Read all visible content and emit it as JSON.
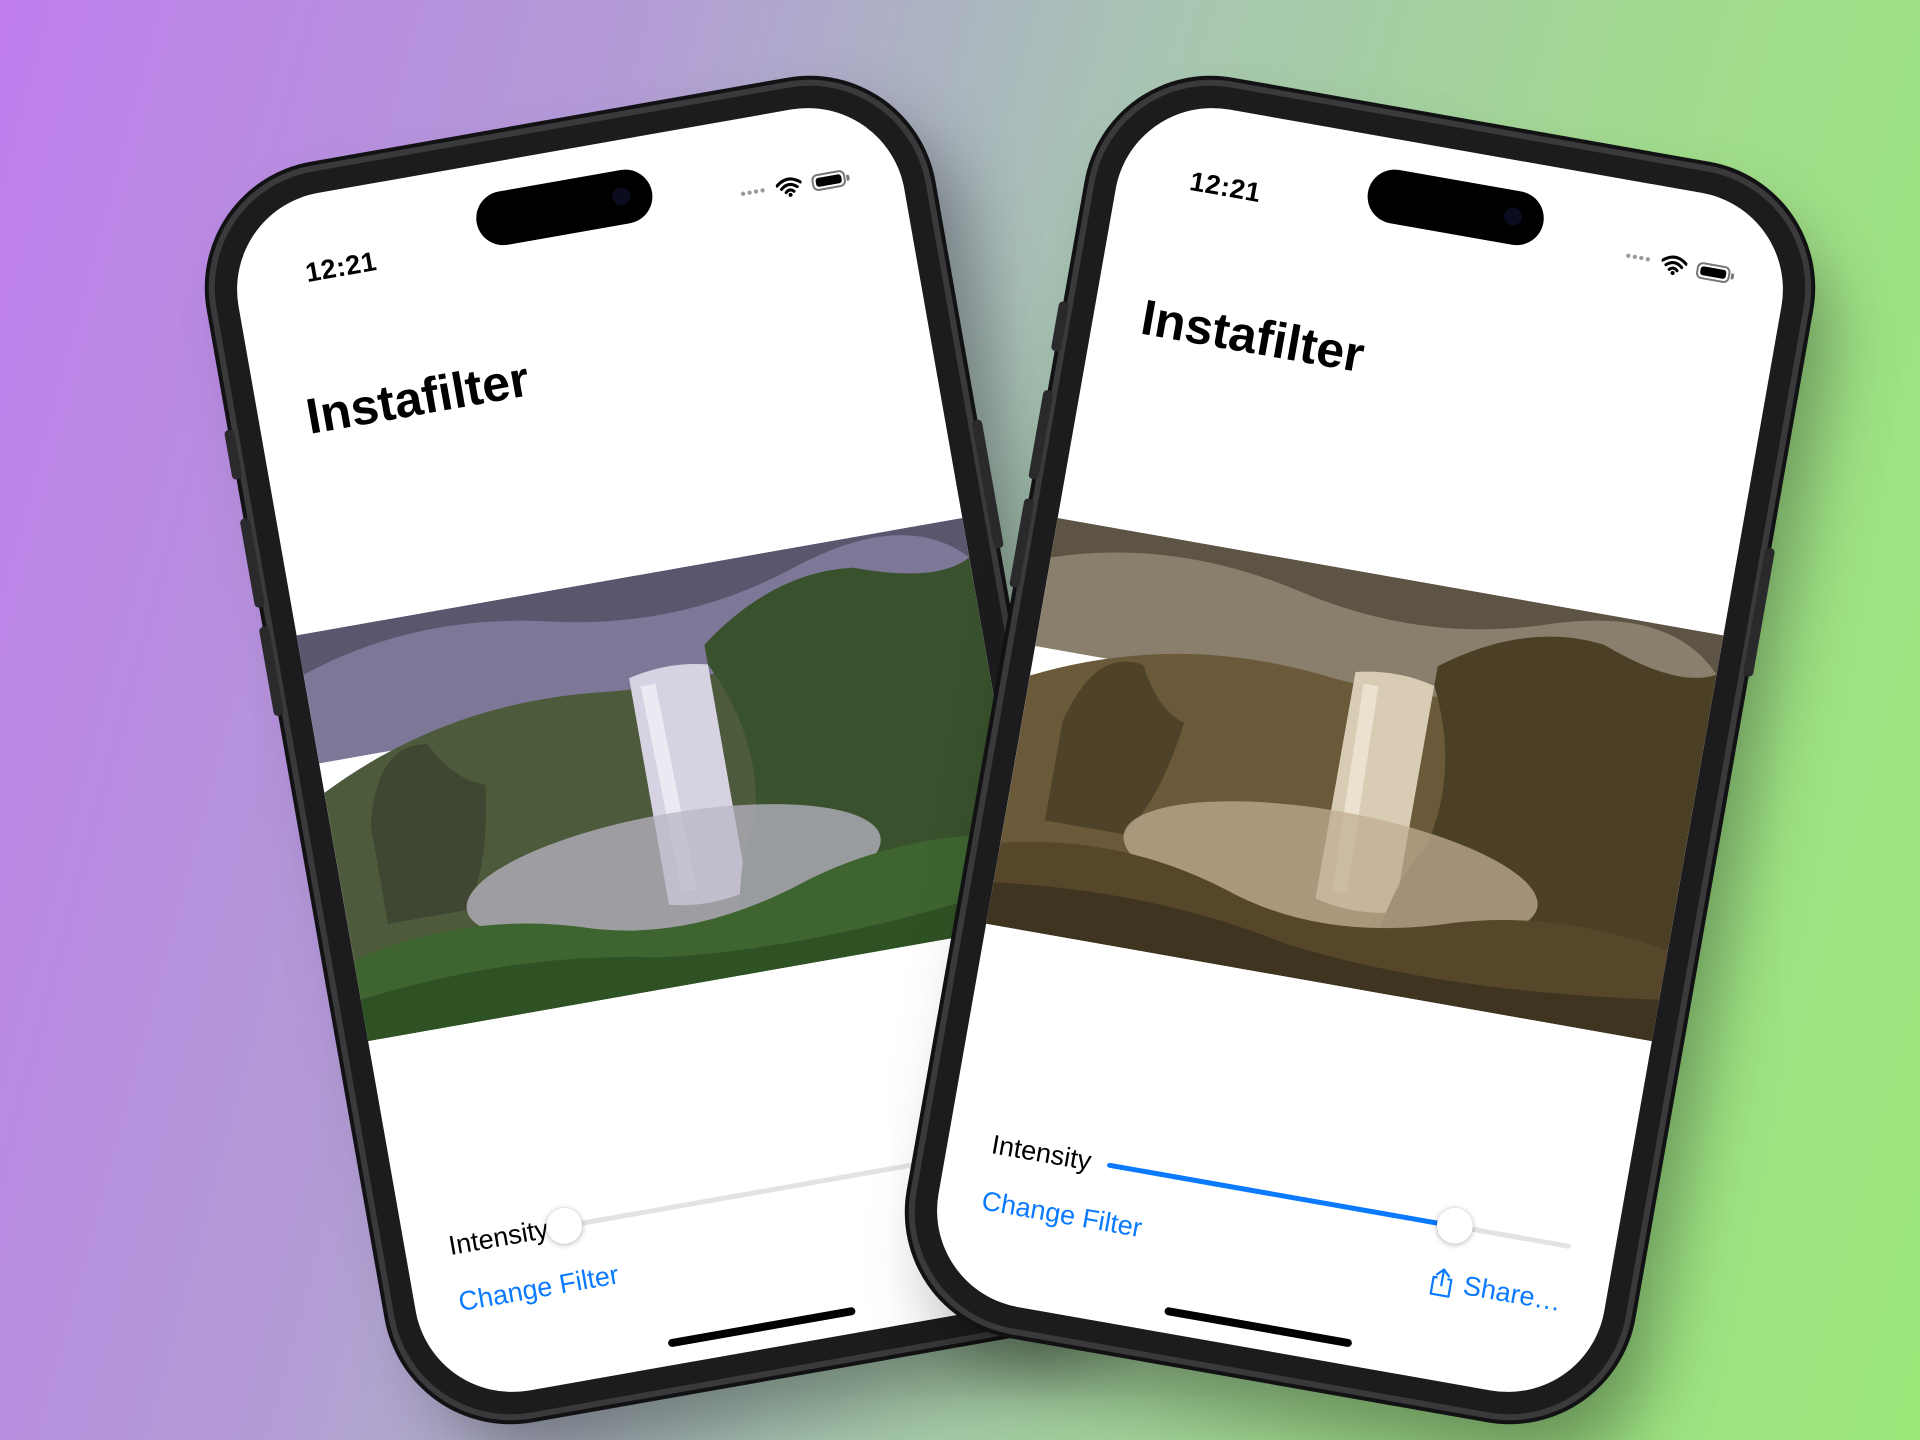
{
  "status_bar": {
    "time": "12:21",
    "cell_signal": "••••",
    "wifi_icon": "wifi-icon",
    "battery_icon": "battery-icon"
  },
  "app": {
    "title": "Instafilter"
  },
  "intensity": {
    "label": "Intensity"
  },
  "actions": {
    "change_filter": "Change Filter",
    "share": "Share…",
    "share_icon": "square-and-arrow-up-icon"
  },
  "phones": [
    {
      "name": "left-phone",
      "filter": "original",
      "intensity_value": 0.0
    },
    {
      "name": "right-phone",
      "filter": "sepia",
      "intensity_value": 0.75
    }
  ],
  "colors": {
    "accent": "#0a7aff",
    "background_left": "#bf7ded",
    "background_right": "#9ce87a"
  }
}
